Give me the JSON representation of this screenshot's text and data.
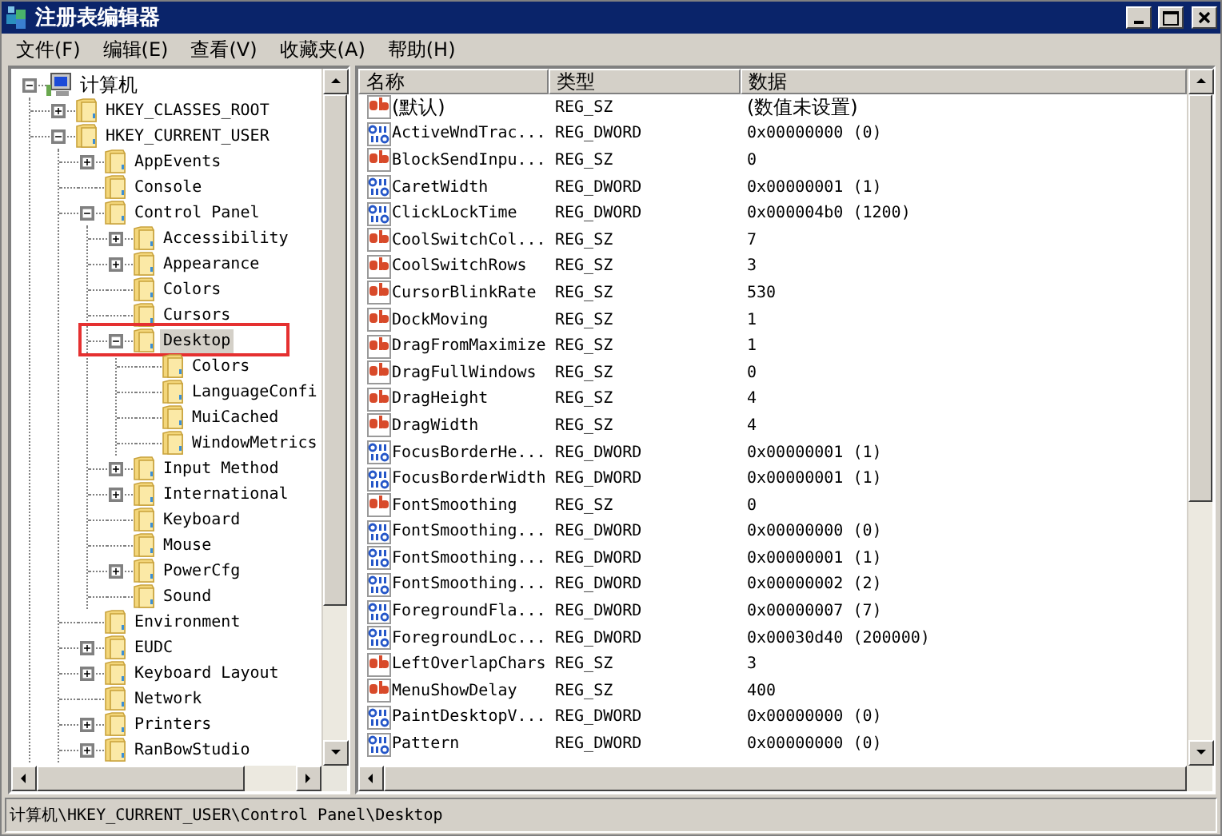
{
  "window": {
    "title": "注册表编辑器"
  },
  "menu": [
    "文件(F)",
    "编辑(E)",
    "查看(V)",
    "收藏夹(A)",
    "帮助(H)"
  ],
  "tree": {
    "items": [
      {
        "label": "计算机",
        "kind": "computer",
        "expanded": true,
        "selected": false,
        "children": [
          {
            "label": "HKEY_CLASSES_ROOT",
            "expanded": false,
            "selected": false
          },
          {
            "label": "HKEY_CURRENT_USER",
            "expanded": true,
            "selected": false,
            "children": [
              {
                "label": "AppEvents",
                "expanded": false,
                "selected": false
              },
              {
                "label": "Console",
                "selected": false
              },
              {
                "label": "Control Panel",
                "expanded": true,
                "selected": false,
                "children": [
                  {
                    "label": "Accessibility",
                    "expanded": false,
                    "selected": false
                  },
                  {
                    "label": "Appearance",
                    "expanded": false,
                    "selected": false
                  },
                  {
                    "label": "Colors",
                    "selected": false
                  },
                  {
                    "label": "Cursors",
                    "selected": false
                  },
                  {
                    "label": "Desktop",
                    "expanded": true,
                    "selected": true,
                    "outlined": true,
                    "children": [
                      {
                        "label": "Colors",
                        "selected": false
                      },
                      {
                        "label": "LanguageConfi",
                        "selected": false
                      },
                      {
                        "label": "MuiCached",
                        "selected": false
                      },
                      {
                        "label": "WindowMetrics",
                        "selected": false
                      }
                    ]
                  },
                  {
                    "label": "Input Method",
                    "expanded": false,
                    "selected": false
                  },
                  {
                    "label": "International",
                    "expanded": false,
                    "selected": false
                  },
                  {
                    "label": "Keyboard",
                    "selected": false
                  },
                  {
                    "label": "Mouse",
                    "selected": false
                  },
                  {
                    "label": "PowerCfg",
                    "expanded": false,
                    "selected": false
                  },
                  {
                    "label": "Sound",
                    "selected": false
                  }
                ]
              },
              {
                "label": "Environment",
                "selected": false
              },
              {
                "label": "EUDC",
                "expanded": false,
                "selected": false
              },
              {
                "label": "Keyboard Layout",
                "expanded": false,
                "selected": false
              },
              {
                "label": "Network",
                "selected": false
              },
              {
                "label": "Printers",
                "expanded": false,
                "selected": false
              },
              {
                "label": "RanBowStudio",
                "expanded": false,
                "selected": false
              }
            ]
          }
        ]
      }
    ]
  },
  "values": {
    "columns": [
      "名称",
      "类型",
      "数据"
    ],
    "rows": [
      {
        "kind": "string",
        "name": "(默认)",
        "type": "REG_SZ",
        "data": "(数值未设置)"
      },
      {
        "kind": "binary",
        "name": "ActiveWndTrac...",
        "type": "REG_DWORD",
        "data": "0x00000000 (0)"
      },
      {
        "kind": "string",
        "name": "BlockSendInpu...",
        "type": "REG_SZ",
        "data": "0"
      },
      {
        "kind": "binary",
        "name": "CaretWidth",
        "type": "REG_DWORD",
        "data": "0x00000001 (1)"
      },
      {
        "kind": "binary",
        "name": "ClickLockTime",
        "type": "REG_DWORD",
        "data": "0x000004b0 (1200)"
      },
      {
        "kind": "string",
        "name": "CoolSwitchCol...",
        "type": "REG_SZ",
        "data": "7"
      },
      {
        "kind": "string",
        "name": "CoolSwitchRows",
        "type": "REG_SZ",
        "data": "3"
      },
      {
        "kind": "string",
        "name": "CursorBlinkRate",
        "type": "REG_SZ",
        "data": "530"
      },
      {
        "kind": "string",
        "name": "DockMoving",
        "type": "REG_SZ",
        "data": "1"
      },
      {
        "kind": "string",
        "name": "DragFromMaximize",
        "type": "REG_SZ",
        "data": "1"
      },
      {
        "kind": "string",
        "name": "DragFullWindows",
        "type": "REG_SZ",
        "data": "0"
      },
      {
        "kind": "string",
        "name": "DragHeight",
        "type": "REG_SZ",
        "data": "4"
      },
      {
        "kind": "string",
        "name": "DragWidth",
        "type": "REG_SZ",
        "data": "4"
      },
      {
        "kind": "binary",
        "name": "FocusBorderHe...",
        "type": "REG_DWORD",
        "data": "0x00000001 (1)"
      },
      {
        "kind": "binary",
        "name": "FocusBorderWidth",
        "type": "REG_DWORD",
        "data": "0x00000001 (1)"
      },
      {
        "kind": "string",
        "name": "FontSmoothing",
        "type": "REG_SZ",
        "data": "0"
      },
      {
        "kind": "binary",
        "name": "FontSmoothing...",
        "type": "REG_DWORD",
        "data": "0x00000000 (0)"
      },
      {
        "kind": "binary",
        "name": "FontSmoothing...",
        "type": "REG_DWORD",
        "data": "0x00000001 (1)"
      },
      {
        "kind": "binary",
        "name": "FontSmoothing...",
        "type": "REG_DWORD",
        "data": "0x00000002 (2)"
      },
      {
        "kind": "binary",
        "name": "ForegroundFla...",
        "type": "REG_DWORD",
        "data": "0x00000007 (7)"
      },
      {
        "kind": "binary",
        "name": "ForegroundLoc...",
        "type": "REG_DWORD",
        "data": "0x00030d40 (200000)"
      },
      {
        "kind": "string",
        "name": "LeftOverlapChars",
        "type": "REG_SZ",
        "data": "3"
      },
      {
        "kind": "string",
        "name": "MenuShowDelay",
        "type": "REG_SZ",
        "data": "400"
      },
      {
        "kind": "binary",
        "name": "PaintDesktopV...",
        "type": "REG_DWORD",
        "data": "0x00000000 (0)"
      },
      {
        "kind": "binary",
        "name": "Pattern",
        "type": "REG_DWORD",
        "data": "0x00000000 (0)"
      }
    ]
  },
  "status_bar": "计算机\\HKEY_CURRENT_USER\\Control Panel\\Desktop"
}
